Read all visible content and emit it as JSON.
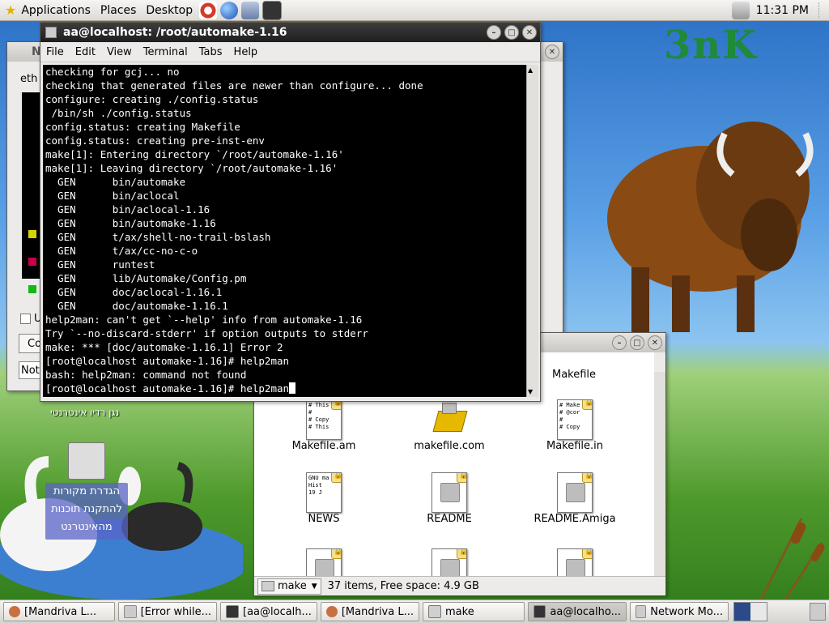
{
  "top_panel": {
    "menus": [
      "Applications",
      "Places",
      "Desktop"
    ],
    "clock": "11:31 PM"
  },
  "desktop": {
    "sky_logo": "3nK",
    "radio_label": "נגן רדיו אינטרנטי",
    "launcher_label_lines": [
      "הגדרת מקורות",
      "להתקנת תוכנות",
      "מהאינטרנט"
    ]
  },
  "network_window": {
    "title_partial": "N",
    "tab_partial": "eth",
    "button_partial": "Co",
    "field_partial": "Not",
    "checkbox_partial": "U"
  },
  "terminal": {
    "title": "aa@localhost: /root/automake-1.16",
    "menu": [
      "File",
      "Edit",
      "View",
      "Terminal",
      "Tabs",
      "Help"
    ],
    "lines": [
      "checking for gcj... no",
      "checking that generated files are newer than configure... done",
      "configure: creating ./config.status",
      " /bin/sh ./config.status",
      "config.status: creating Makefile",
      "config.status: creating pre-inst-env",
      "make[1]: Entering directory `/root/automake-1.16'",
      "make[1]: Leaving directory `/root/automake-1.16'",
      "  GEN      bin/automake",
      "  GEN      bin/aclocal",
      "  GEN      bin/aclocal-1.16",
      "  GEN      bin/automake-1.16",
      "  GEN      t/ax/shell-no-trail-bslash",
      "  GEN      t/ax/cc-no-c-o",
      "  GEN      runtest",
      "  GEN      lib/Automake/Config.pm",
      "  GEN      doc/aclocal-1.16.1",
      "  GEN      doc/automake-1.16.1",
      "help2man: can't get `--help' info from automake-1.16",
      "Try `--no-discard-stderr' if option outputs to stderr",
      "make: *** [doc/automake-1.16.1] Error 2",
      "[root@localhost automake-1.16]# help2man",
      "bash: help2man: command not found"
    ],
    "prompt": "[root@localhost automake-1.16]# help2man"
  },
  "file_manager": {
    "partial_top_label": "Makefile",
    "files": [
      {
        "name": "Makefile.am",
        "preview": [
          "# This",
          "#",
          "# Copy",
          "# This"
        ]
      },
      {
        "name": "makefile.com",
        "preview": []
      },
      {
        "name": "Makefile.in",
        "preview": [
          "# Make",
          "# @cor",
          "#",
          "# Copy"
        ]
      },
      {
        "name": "NEWS",
        "preview": [
          "GNU ma",
          "  Hist",
          "  19 J"
        ]
      },
      {
        "name": "README",
        "preview": []
      },
      {
        "name": "README.Amiga",
        "preview": []
      }
    ],
    "location": "make",
    "status": "37 items, Free space: 4.9 GB"
  },
  "taskbar": [
    {
      "label": "[Mandriva L...",
      "active": false
    },
    {
      "label": "[Error while...",
      "active": false
    },
    {
      "label": "[aa@localh...",
      "active": false
    },
    {
      "label": "[Mandriva L...",
      "active": false
    },
    {
      "label": "make",
      "active": false
    },
    {
      "label": "aa@localho...",
      "active": true
    },
    {
      "label": "Network Mo...",
      "active": false
    }
  ]
}
